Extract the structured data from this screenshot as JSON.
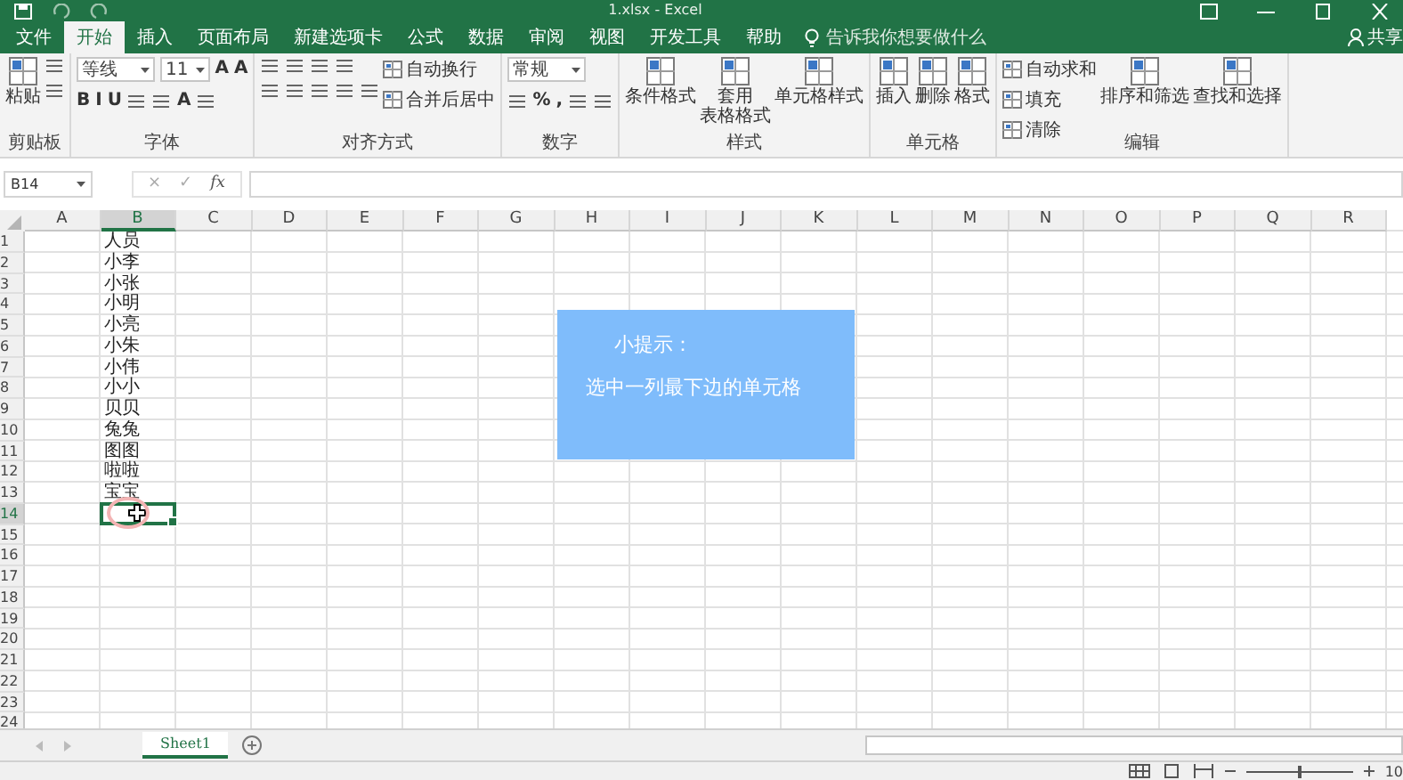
{
  "window": {
    "title": "1.xlsx - Excel"
  },
  "menu_tabs": [
    {
      "label": "文件",
      "selected": false
    },
    {
      "label": "开始",
      "selected": true
    },
    {
      "label": "插入",
      "selected": false
    },
    {
      "label": "页面布局",
      "selected": false
    },
    {
      "label": "新建选项卡",
      "selected": false
    },
    {
      "label": "公式",
      "selected": false
    },
    {
      "label": "数据",
      "selected": false
    },
    {
      "label": "审阅",
      "selected": false
    },
    {
      "label": "视图",
      "selected": false
    },
    {
      "label": "开发工具",
      "selected": false
    },
    {
      "label": "帮助",
      "selected": false
    }
  ],
  "tell_me": {
    "placeholder": "告诉我你想要做什么"
  },
  "share": "共享",
  "ribbon": [
    {
      "label": "剪贴板",
      "columns": [
        {
          "kind": "large",
          "lines": [
            "粘贴"
          ]
        },
        {
          "kind": "stack",
          "rows": [
            {
              "items": [
                {
                  "kind": "icon"
                }
              ]
            },
            {
              "items": [
                {
                  "kind": "icon"
                }
              ]
            }
          ]
        }
      ]
    },
    {
      "label": "字体",
      "columns": [
        {
          "kind": "stack",
          "rows": [
            {
              "items": [
                {
                  "kind": "field",
                  "value": "等线"
                },
                {
                  "kind": "field",
                  "value": "11"
                },
                {
                  "kind": "glyph",
                  "text": "A"
                },
                {
                  "kind": "glyph",
                  "text": "A"
                }
              ]
            },
            {
              "items": [
                {
                  "kind": "glyph",
                  "text": "B"
                },
                {
                  "kind": "glyph",
                  "text": "I"
                },
                {
                  "kind": "glyph",
                  "text": "U"
                },
                {
                  "kind": "icon"
                },
                {
                  "kind": "icon"
                },
                {
                  "kind": "glyph",
                  "text": "A"
                },
                {
                  "kind": "icon"
                }
              ]
            }
          ]
        }
      ]
    },
    {
      "label": "对齐方式",
      "columns": [
        {
          "kind": "stack",
          "rows": [
            {
              "items": [
                {
                  "kind": "icon"
                },
                {
                  "kind": "icon"
                },
                {
                  "kind": "icon"
                },
                {
                  "kind": "icon"
                }
              ]
            },
            {
              "items": [
                {
                  "kind": "icon"
                },
                {
                  "kind": "icon"
                },
                {
                  "kind": "icon"
                },
                {
                  "kind": "icon"
                },
                {
                  "kind": "icon"
                }
              ]
            }
          ]
        },
        {
          "kind": "stack",
          "rows": [
            {
              "items": [
                {
                  "kind": "small",
                  "label": "自动换行"
                }
              ]
            },
            {
              "items": [
                {
                  "kind": "small",
                  "label": "合并后居中"
                }
              ]
            }
          ]
        }
      ]
    },
    {
      "label": "数字",
      "columns": [
        {
          "kind": "stack",
          "rows": [
            {
              "items": [
                {
                  "kind": "field",
                  "value": "常规"
                }
              ]
            },
            {
              "items": [
                {
                  "kind": "icon"
                },
                {
                  "kind": "glyph",
                  "text": "%"
                },
                {
                  "kind": "glyph",
                  "text": ","
                },
                {
                  "kind": "icon"
                },
                {
                  "kind": "icon"
                }
              ]
            }
          ]
        }
      ]
    },
    {
      "label": "样式",
      "columns": [
        {
          "kind": "large",
          "lines": [
            "条件格式"
          ]
        },
        {
          "kind": "large",
          "lines": [
            "套用",
            "表格格式"
          ]
        },
        {
          "kind": "large",
          "lines": [
            "单元格样式"
          ]
        }
      ]
    },
    {
      "label": "单元格",
      "columns": [
        {
          "kind": "large",
          "lines": [
            "插入"
          ]
        },
        {
          "kind": "large",
          "lines": [
            "删除"
          ]
        },
        {
          "kind": "large",
          "lines": [
            "格式"
          ]
        }
      ]
    },
    {
      "label": "编辑",
      "columns": [
        {
          "kind": "stack",
          "rows": [
            {
              "items": [
                {
                  "kind": "small",
                  "label": "自动求和"
                }
              ]
            },
            {
              "items": [
                {
                  "kind": "small",
                  "label": "填充"
                }
              ]
            },
            {
              "items": [
                {
                  "kind": "small",
                  "label": "清除"
                }
              ]
            }
          ]
        },
        {
          "kind": "large",
          "lines": [
            "排序和筛选"
          ]
        },
        {
          "kind": "large",
          "lines": [
            "查找和选择"
          ]
        }
      ]
    }
  ],
  "formula_bar": {
    "name_box": "B14",
    "cancel": "×",
    "enter": "✓",
    "function": "fx"
  },
  "sheet": {
    "columns": [
      {
        "label": "A",
        "selected": false
      },
      {
        "label": "B",
        "selected": true,
        "cells": [
          "人员",
          "小李",
          "小张",
          "小明",
          "小亮",
          "小朱",
          "小伟",
          "小小",
          "贝贝",
          "兔兔",
          "图图",
          "啦啦",
          "宝宝"
        ]
      },
      {
        "label": "C",
        "selected": false
      },
      {
        "label": "D",
        "selected": false
      },
      {
        "label": "E",
        "selected": false
      },
      {
        "label": "F",
        "selected": false
      },
      {
        "label": "G",
        "selected": false
      },
      {
        "label": "H",
        "selected": false
      },
      {
        "label": "I",
        "selected": false
      },
      {
        "label": "J",
        "selected": false
      },
      {
        "label": "K",
        "selected": false
      },
      {
        "label": "L",
        "selected": false
      },
      {
        "label": "M",
        "selected": false
      },
      {
        "label": "N",
        "selected": false
      },
      {
        "label": "O",
        "selected": false
      },
      {
        "label": "P",
        "selected": false
      },
      {
        "label": "Q",
        "selected": false
      },
      {
        "label": "R",
        "selected": false
      }
    ],
    "rows": [
      {
        "label": "1",
        "selected": false
      },
      {
        "label": "2",
        "selected": false
      },
      {
        "label": "3",
        "selected": false
      },
      {
        "label": "4",
        "selected": false
      },
      {
        "label": "5",
        "selected": false
      },
      {
        "label": "6",
        "selected": false
      },
      {
        "label": "7",
        "selected": false
      },
      {
        "label": "8",
        "selected": false
      },
      {
        "label": "9",
        "selected": false
      },
      {
        "label": "10",
        "selected": false
      },
      {
        "label": "11",
        "selected": false
      },
      {
        "label": "12",
        "selected": false
      },
      {
        "label": "13",
        "selected": false
      },
      {
        "label": "14",
        "selected": true
      },
      {
        "label": "15",
        "selected": false
      },
      {
        "label": "16",
        "selected": false
      },
      {
        "label": "17",
        "selected": false
      },
      {
        "label": "18",
        "selected": false
      },
      {
        "label": "19",
        "selected": false
      },
      {
        "label": "20",
        "selected": false
      },
      {
        "label": "21",
        "selected": false
      },
      {
        "label": "22",
        "selected": false
      },
      {
        "label": "23",
        "selected": false
      },
      {
        "label": "24",
        "selected": false
      }
    ]
  },
  "callout": {
    "title": "小提示：",
    "text": "选中一列最下边的单元格"
  },
  "sheet_tabs": [
    {
      "label": "Sheet1",
      "selected": true
    }
  ],
  "status_bar": {
    "zoom_slider": {
      "level": 0.5
    },
    "zoom": "10"
  }
}
